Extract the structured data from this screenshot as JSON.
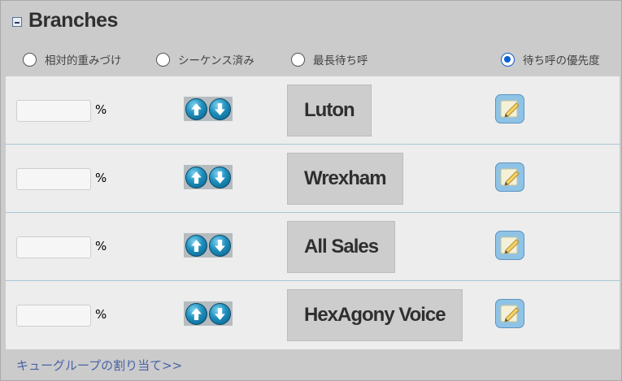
{
  "header": {
    "title": "Branches"
  },
  "radio_options": [
    {
      "label": "相対的重みづけ",
      "selected": false
    },
    {
      "label": "シーケンス済み",
      "selected": false
    },
    {
      "label": "最長待ち呼",
      "selected": false
    },
    {
      "label": "待ち呼の優先度",
      "selected": true
    }
  ],
  "rows": [
    {
      "name": "Luton",
      "percent_value": "",
      "percent_unit": "%"
    },
    {
      "name": "Wrexham",
      "percent_value": "",
      "percent_unit": "%"
    },
    {
      "name": "All Sales",
      "percent_value": "",
      "percent_unit": "%"
    },
    {
      "name": "HexAgony Voice",
      "percent_value": "",
      "percent_unit": "%"
    }
  ],
  "icons": {
    "collapse": "minus-square-icon",
    "move_up": "arrow-up-icon",
    "move_down": "arrow-down-icon",
    "edit": "edit-pencil-icon"
  },
  "footer": {
    "link_label": "キューグループの割り当て>>"
  },
  "colors": {
    "panel_bg": "#cbcbcb",
    "rows_bg": "#ededed",
    "row_divider": "#a7c6d6",
    "radio_selected": "#0a5fd1",
    "link": "#4a63a8"
  }
}
